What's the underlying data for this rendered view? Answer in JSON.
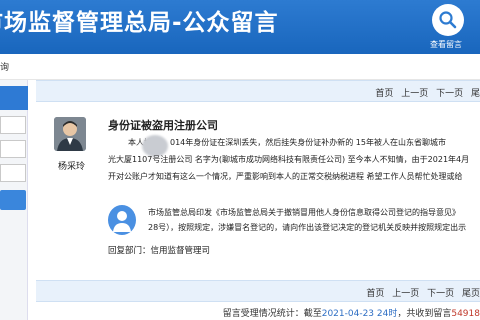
{
  "header": {
    "title": "市场监督管理总局-公众留言",
    "view_messages_label": "查看留言"
  },
  "nav": {
    "crumb": "询"
  },
  "pager_top": {
    "first": "首页",
    "prev": "上一页",
    "next": "下一页",
    "last": "尾"
  },
  "message": {
    "author": "杨采玲",
    "subject": "身份证被盗用注册公司",
    "body_lines": [
      "本人姓",
      "014年身份证在深圳丢失，然后挂失身份证补办新的 15年被人在山东省聊城市",
      "光大厦1107号注册公司 名字为(聊城市成功网络科技有限责任公司) 至今本人不知情，由于2021年4月",
      "开对公账户才知道有这么一个情况，严重影响到本人的正常交税纳税进程 希望工作人员帮忙处理或给"
    ],
    "reply_lines": [
      "市场监管总局印发《市场监管总局关于撤销冒用他人身份信息取得公司登记的指导意见》",
      "28号），按照规定，涉嫌冒名登记的，请向作出该登记决定的登记机关反映并按照规定出示"
    ],
    "reply_dept": "回复部门：信用监督管理司"
  },
  "pager_bottom": {
    "first": "首页",
    "prev": "上一页",
    "next": "下一页",
    "last": "尾页"
  },
  "stats": {
    "prefix": "留言受理情况统计：截至",
    "date": "2021-04-23 24时",
    "middle": "，共收到留言",
    "count": "54918"
  }
}
